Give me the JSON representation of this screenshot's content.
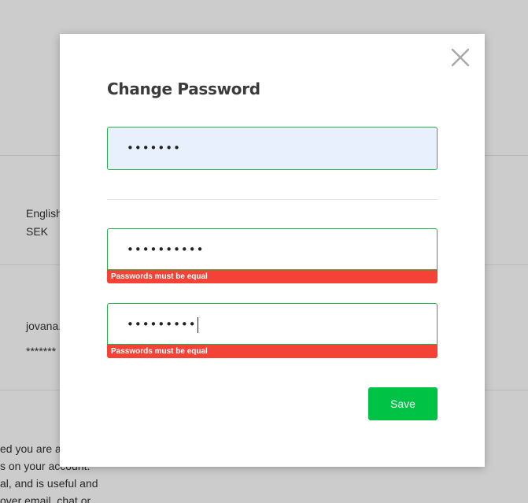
{
  "background": {
    "language": "English",
    "currency": "SEK",
    "username": "jovana.",
    "password_mask": "*******",
    "description_lines": [
      "ed you are all",
      "s on your account.",
      "al, and is useful and",
      "over email, chat or"
    ]
  },
  "modal": {
    "title": "Change Password",
    "close_icon": "close-icon",
    "current_password": {
      "value": "•••••••"
    },
    "new_password": {
      "value": "••••••••••",
      "error": "Passwords must be equal"
    },
    "confirm_password": {
      "value": "•••••••••",
      "error": "Passwords must be equal"
    },
    "save_label": "Save"
  },
  "colors": {
    "accent": "#00c244",
    "field_border": "#25b24a",
    "error": "#f44336",
    "autofill_bg": "#e8f0fe"
  }
}
